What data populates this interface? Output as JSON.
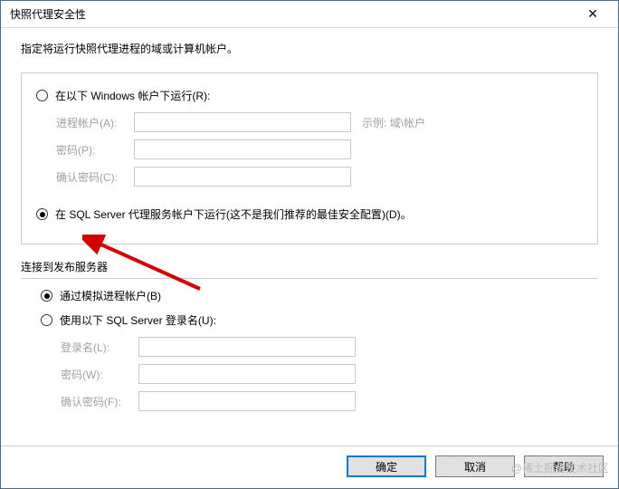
{
  "dialog": {
    "title": "快照代理安全性",
    "instruction": "指定将运行快照代理进程的域或计算机帐户。"
  },
  "option1": {
    "label": "在以下 Windows 帐户下运行(R):",
    "account_label": "进程帐户(A):",
    "account_value": "",
    "account_hint": "示例: 域\\帐户",
    "password_label": "密码(P):",
    "password_value": "",
    "confirm_label": "确认密码(C):",
    "confirm_value": ""
  },
  "option2": {
    "label": "在 SQL Server 代理服务帐户下运行(这不是我们推荐的最佳安全配置)(D)。"
  },
  "connect": {
    "section_label": "连接到发布服务器",
    "impersonate_label": "通过模拟进程帐户(B)",
    "sql_login_label": "使用以下 SQL Server 登录名(U):",
    "login_label": "登录名(L):",
    "login_value": "",
    "password_label": "密码(W):",
    "password_value": "",
    "confirm_label": "确认密码(F):",
    "confirm_value": ""
  },
  "buttons": {
    "ok": "确定",
    "cancel": "取消",
    "help": "帮助"
  },
  "watermark": "@稀土掘金技术社区"
}
